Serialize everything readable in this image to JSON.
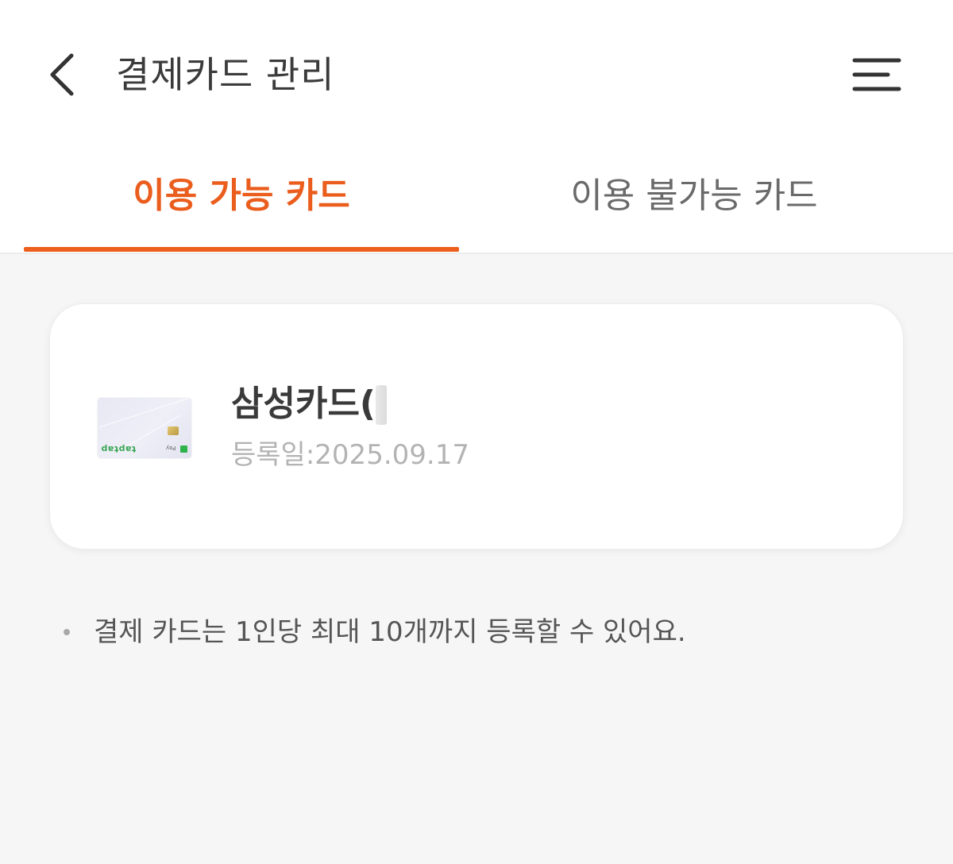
{
  "header": {
    "title": "결제카드 관리",
    "back_icon": "chevron-left-icon",
    "menu_icon": "hamburger-menu-icon"
  },
  "tabs": [
    {
      "label": "이용 가능 카드",
      "active": true
    },
    {
      "label": "이용 불가능 카드",
      "active": false
    }
  ],
  "cards": [
    {
      "name": "삼성카드(",
      "registered": "등록일:2025.09.17",
      "thumbnail_brand": "taptap",
      "thumbnail_pay": "Pay"
    }
  ],
  "notice": {
    "text": "결제 카드는 1인당 최대 10개까지 등록할 수 있어요."
  },
  "colors": {
    "accent": "#ea5d1d",
    "background": "#f6f6f6",
    "card_surface": "#ffffff"
  }
}
